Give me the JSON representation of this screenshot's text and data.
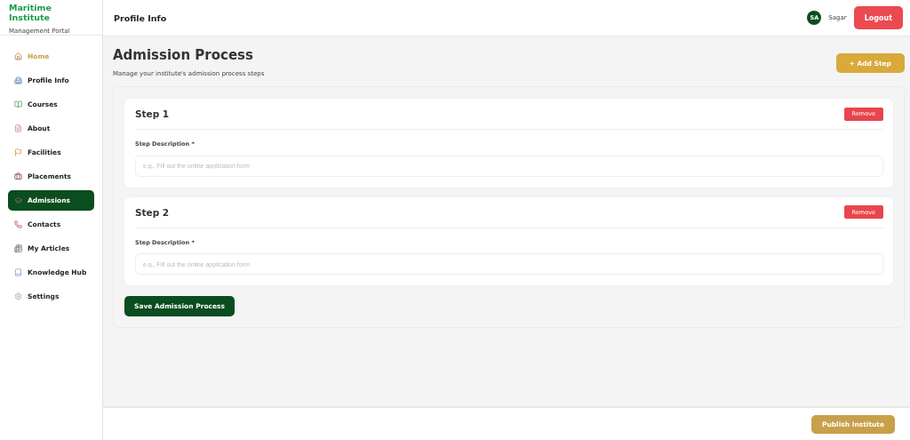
{
  "brand": {
    "title": "Maritime Institute",
    "subtitle": "Management Portal"
  },
  "sidebar": {
    "items": [
      {
        "label": "Home",
        "selected": false,
        "highlighted": true
      },
      {
        "label": "Profile Info",
        "selected": false,
        "highlighted": false
      },
      {
        "label": "Courses",
        "selected": false,
        "highlighted": false
      },
      {
        "label": "About",
        "selected": false,
        "highlighted": false
      },
      {
        "label": "Facilities",
        "selected": false,
        "highlighted": false
      },
      {
        "label": "Placements",
        "selected": false,
        "highlighted": false
      },
      {
        "label": "Admissions",
        "selected": true,
        "highlighted": false
      },
      {
        "label": "Contacts",
        "selected": false,
        "highlighted": false
      },
      {
        "label": "My Articles",
        "selected": false,
        "highlighted": false
      },
      {
        "label": "Knowledge Hub",
        "selected": false,
        "highlighted": false
      },
      {
        "label": "Settings",
        "selected": false,
        "highlighted": false
      }
    ]
  },
  "header": {
    "title": "Profile Info",
    "user": {
      "initials": "SA",
      "name": "Sagar"
    },
    "logout": "Logout"
  },
  "page": {
    "title": "Admission Process",
    "subtitle": "Manage your institute's admission process steps",
    "add_button": "+ Add Step"
  },
  "steps": [
    {
      "title": "Step 1",
      "remove": "Remove",
      "label": "Step Description *",
      "placeholder": "e.g., Fill out the online application form"
    },
    {
      "title": "Step 2",
      "remove": "Remove",
      "label": "Step Description *",
      "placeholder": "e.g., Fill out the online application form"
    }
  ],
  "save_button": "Save Admission Process",
  "footer": {
    "publish_button": "Publish Institute"
  }
}
